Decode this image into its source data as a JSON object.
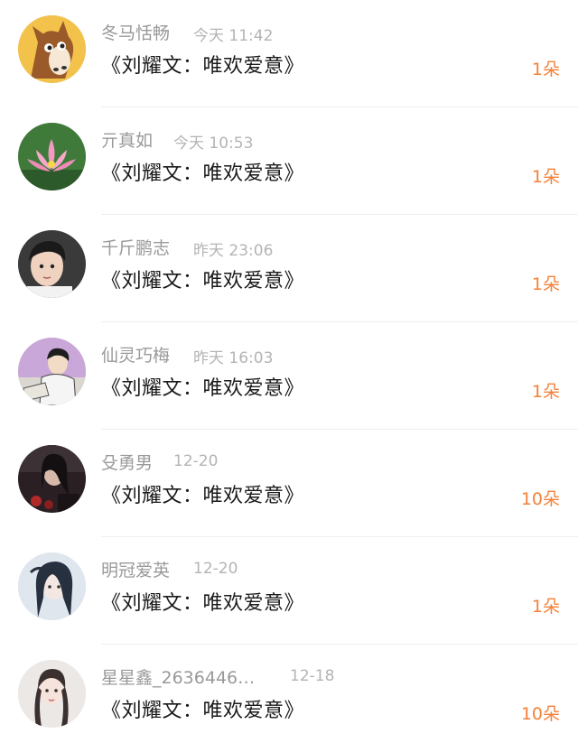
{
  "items": [
    {
      "user": "冬马恬畅",
      "time": "今天 11:42",
      "title": "《刘耀文：唯欢爱意》",
      "count": "1朵"
    },
    {
      "user": "亓真如",
      "time": "今天 10:53",
      "title": "《刘耀文：唯欢爱意》",
      "count": "1朵"
    },
    {
      "user": "千斤鹏志",
      "time": "昨天 23:06",
      "title": "《刘耀文：唯欢爱意》",
      "count": "1朵"
    },
    {
      "user": "仙灵巧梅",
      "time": "昨天 16:03",
      "title": "《刘耀文：唯欢爱意》",
      "count": "1朵"
    },
    {
      "user": "殳勇男",
      "time": "12-20",
      "title": "《刘耀文：唯欢爱意》",
      "count": "10朵"
    },
    {
      "user": "明冠爱英",
      "time": "12-20",
      "title": "《刘耀文：唯欢爱意》",
      "count": "1朵"
    },
    {
      "user": "星星鑫_2636446…",
      "time": "12-18",
      "title": "《刘耀文：唯欢爱意》",
      "count": "10朵"
    }
  ],
  "colors": {
    "count": "#f4823a",
    "name": "#999999",
    "time": "#b4b4b4",
    "title": "#1a1a1a"
  }
}
